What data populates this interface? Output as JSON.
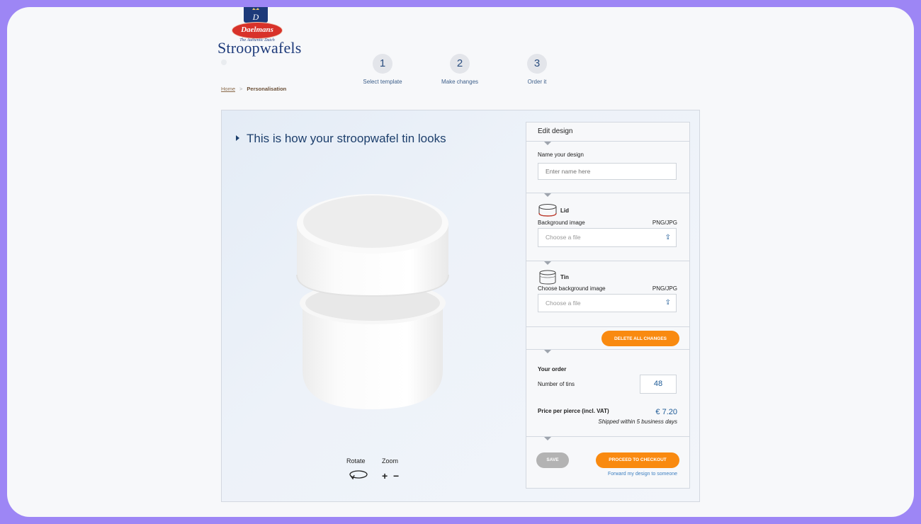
{
  "brand": {
    "oval_text": "Daelmans",
    "tagline": "The Authentic Dutch",
    "name": "Stroopwafels",
    "colors": {
      "navy": "#1d3a7a",
      "red": "#d8322a",
      "orange": "#f98a10"
    }
  },
  "steps": [
    {
      "num": "1",
      "label": "Select template"
    },
    {
      "num": "2",
      "label": "Make changes"
    },
    {
      "num": "3",
      "label": "Order it"
    }
  ],
  "breadcrumb": {
    "home": "Home",
    "separator": ">",
    "current": "Personalisation"
  },
  "preview": {
    "title": "This is how your stroopwafel tin looks",
    "rotate_label": "Rotate",
    "zoom_label": "Zoom",
    "zoom_in": "+",
    "zoom_out": "−"
  },
  "editor": {
    "heading": "Edit design",
    "name_label": "Name your design",
    "name_placeholder": "Enter name here",
    "name_value": "",
    "lid": {
      "title": "Lid",
      "bg_label": "Background image",
      "format": "PNG/JPG",
      "file_placeholder": "Choose a file",
      "icon": "upload-icon"
    },
    "tin": {
      "title": "Tin",
      "bg_label": "Choose background image",
      "format": "PNG/JPG",
      "file_placeholder": "Choose a file",
      "icon": "upload-icon"
    },
    "delete_label": "DELETE ALL CHANGES",
    "order": {
      "title": "Your order",
      "qty_label": "Number of tins",
      "qty_value": "48",
      "price_label": "Price per pierce (incl. VAT)",
      "price_value": "€ 7.20",
      "shipping": "Shipped within 5 business days"
    },
    "save_label": "SAVE",
    "checkout_label": "PROCEED TO CHECKOUT",
    "forward_label": "Forward my design to someone"
  }
}
